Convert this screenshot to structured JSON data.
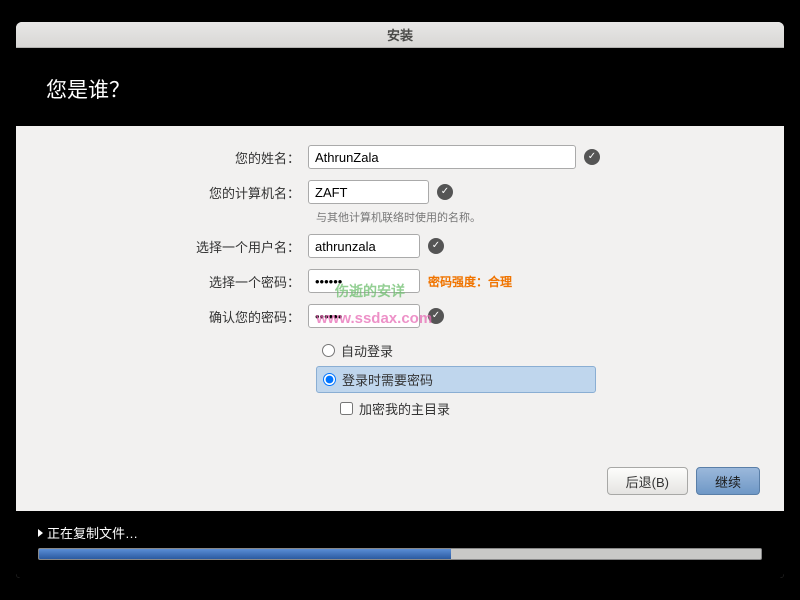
{
  "titlebar": {
    "title": "安装"
  },
  "header": {
    "title": "您是谁？"
  },
  "form": {
    "name": {
      "label": "您的姓名：",
      "value": "AthrunZala"
    },
    "hostname": {
      "label": "您的计算机名：",
      "value": "ZAFT",
      "hint": "与其他计算机联络时使用的名称。"
    },
    "username": {
      "label": "选择一个用户名：",
      "value": "athrunzala"
    },
    "password": {
      "label": "选择一个密码：",
      "value": "••••••",
      "strength_prefix": "密码强度：",
      "strength_value": "合理"
    },
    "confirm": {
      "label": "确认您的密码：",
      "value": "••••••"
    },
    "auto_login": {
      "label": "自动登录"
    },
    "require_password": {
      "label": "登录时需要密码"
    },
    "encrypt_home": {
      "label": "加密我的主目录"
    }
  },
  "buttons": {
    "back": "后退(B)",
    "continue": "继续"
  },
  "progress": {
    "label": "正在复制文件…",
    "percent": 57
  },
  "watermark": {
    "line1": "伤逝的安详",
    "line2": "www.ssdax.com"
  }
}
